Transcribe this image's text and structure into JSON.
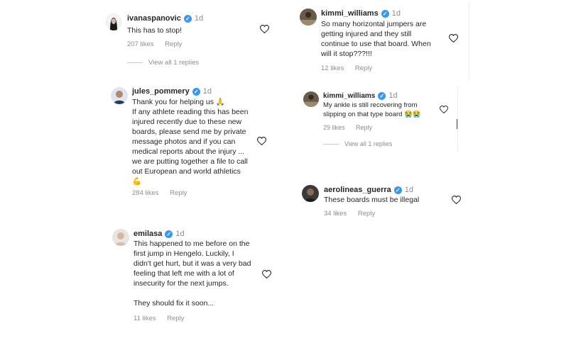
{
  "comments": [
    {
      "username": "ivanaspanovic",
      "time": "1d",
      "text": "This has to stop!",
      "likes": "207 likes",
      "reply": "Reply",
      "view_all": "View all 1 replies",
      "verified_mark": "✓"
    },
    {
      "username": "kimmi_williams",
      "time": "1d",
      "text": "So many horizontal jumpers are\ngetting injured and they still\ncontinue to use that board. When\nwill it stop???!!!",
      "likes": "12 likes",
      "reply": "Reply",
      "verified_mark": "✓"
    },
    {
      "username": "jules_pommery",
      "time": "1d",
      "text": "Thank you for helping us 🙏\nIf any athlete reading this has been\ninjured recently due to these new\nboards, please send me by private\nmessage photos and if you can\nmedical reports about the injury ...\nwe are putting together a file to call\nout European and world athletics\n💪",
      "likes": "284 likes",
      "reply": "Reply",
      "verified_mark": "✓"
    },
    {
      "username": "kimmi_williams",
      "time": "1d",
      "text": "My ankle is still recovering from\nslipping on that type board 😭😭",
      "likes": "29 likes",
      "reply": "Reply",
      "view_all": "View all 1 replies",
      "verified_mark": "✓"
    },
    {
      "username": "aerolineas_guerra",
      "time": "1d",
      "text": "These boards must be illegal",
      "likes": "34 likes",
      "reply": "Reply",
      "verified_mark": "✓"
    },
    {
      "username": "emilasa",
      "time": "1d",
      "text": "This happened to me before on the\nfirst jump in Hengelo. Luckily, I\ndidn't get hurt, but it was a very bad\nfeeling that left me with a lot of\ninsecurity for the next jumps.\n\nThey should fix it soon...",
      "likes": "11 likes",
      "reply": "Reply",
      "verified_mark": "✓"
    }
  ],
  "icons": {
    "like": "heart-outline-icon",
    "verified": "verified-badge-icon",
    "avatar": "profile-avatar"
  },
  "colors": {
    "verified": "#3897f0",
    "muted": "#8e8e8e",
    "text": "#262626"
  }
}
